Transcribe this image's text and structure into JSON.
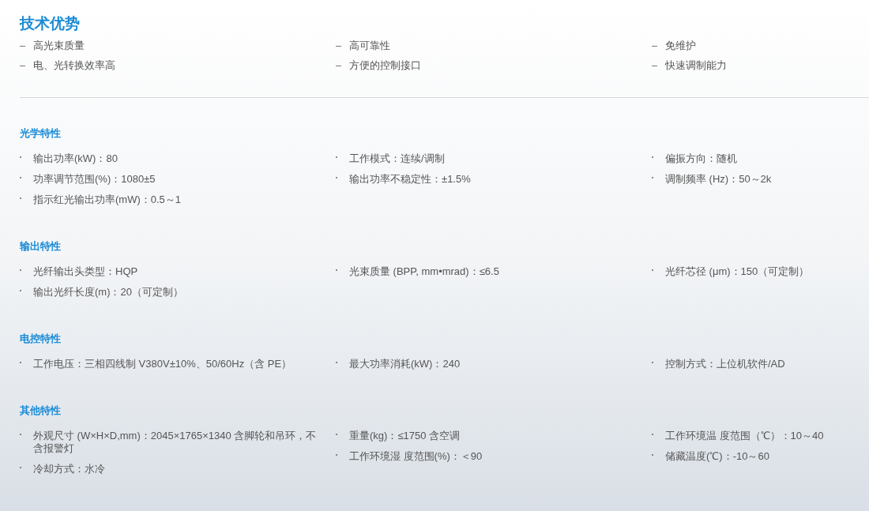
{
  "title": "技术优势",
  "advantages": {
    "kind": "dash",
    "columns": [
      [
        "高光束质量",
        "电、光转换效率高"
      ],
      [
        "高可靠性",
        "方便的控制接口"
      ],
      [
        "免维护",
        "快速调制能力"
      ]
    ]
  },
  "sections": [
    {
      "title": "光学特性",
      "kind": "dot",
      "columns": [
        [
          "输出功率(kW)：80",
          "功率调节范围(%)：1080±5",
          "指示红光输出功率(mW)：0.5～1"
        ],
        [
          "工作模式：连续/调制",
          "输出功率不稳定性：±1.5%"
        ],
        [
          "偏振方向：随机",
          "调制频率 (Hz)：50～2k"
        ]
      ]
    },
    {
      "title": "输出特性",
      "kind": "dot",
      "columns": [
        [
          "光纤输出头类型：HQP",
          "输出光纤长度(m)：20（可定制）"
        ],
        [
          "光束质量 (BPP, mm•mrad)：≤6.5"
        ],
        [
          "光纤芯径 (μm)：150（可定制）"
        ]
      ]
    },
    {
      "title": "电控特性",
      "kind": "dot",
      "columns": [
        [
          "工作电压：三相四线制 V380V±10%、50/60Hz（含 PE）"
        ],
        [
          "最大功率消耗(kW)：240"
        ],
        [
          "控制方式：上位机软件/AD"
        ]
      ]
    },
    {
      "title": "其他特性",
      "kind": "dot",
      "columns": [
        [
          "外观尺寸 (W×H×D,mm)：2045×1765×1340 含脚轮和吊环，不含报警灯",
          "冷却方式：水冷"
        ],
        [
          "重量(kg)：≤1750 含空调",
          "工作环境湿 度范围(%)：＜90"
        ],
        [
          "工作环境温 度范围（℃）：10～40",
          "储藏温度(℃)：-10～60"
        ]
      ]
    }
  ]
}
